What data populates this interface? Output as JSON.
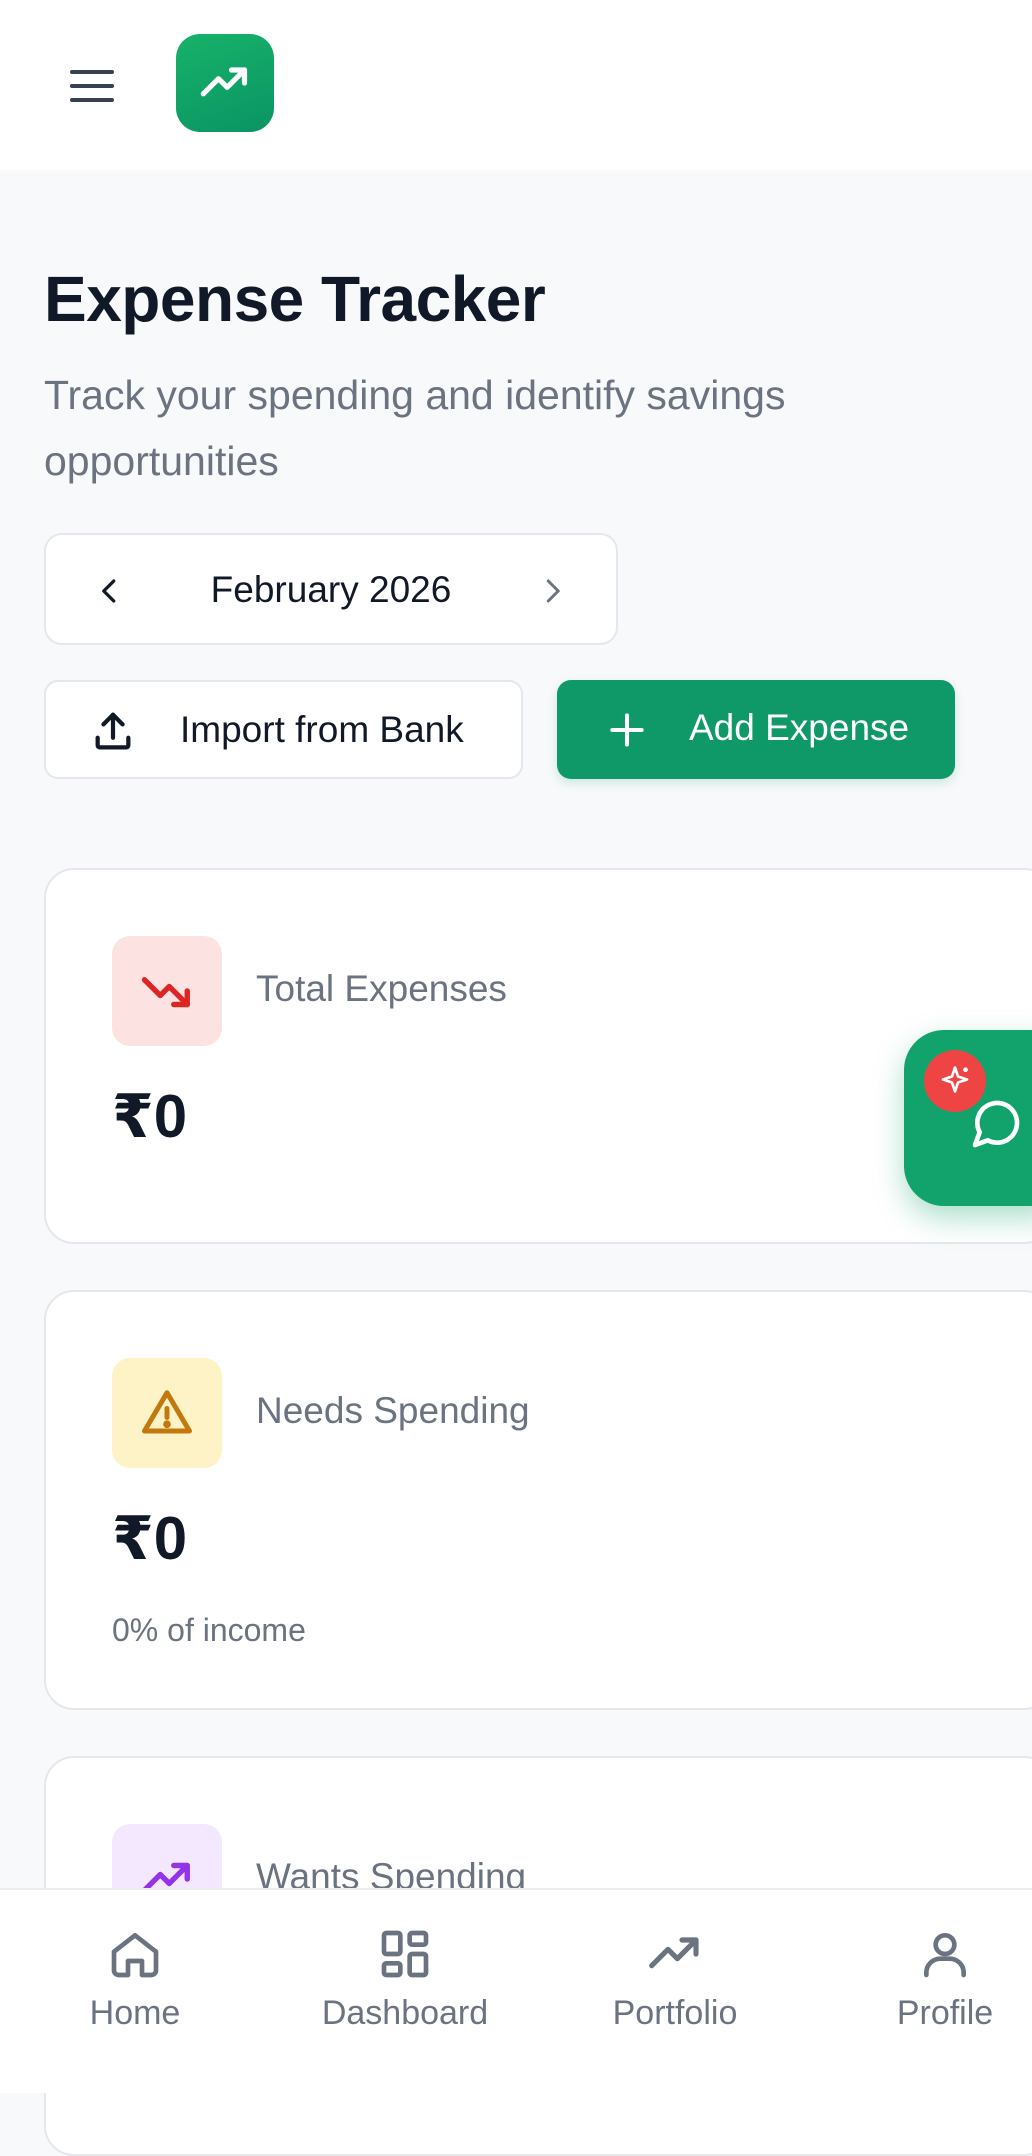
{
  "header": {
    "menu_icon": "hamburger-icon",
    "logo_icon": "trending-up-icon"
  },
  "page": {
    "title": "Expense Tracker",
    "subtitle": "Track your spending and identify savings opportunities"
  },
  "month_picker": {
    "label": "February 2026"
  },
  "actions": {
    "import_label": "Import from Bank",
    "add_label": "Add Expense"
  },
  "cards": [
    {
      "label": "Total Expenses",
      "value": "₹0",
      "icon": "trending-down-icon",
      "badge_color": "#fde2e2",
      "icon_color": "#dc2626"
    },
    {
      "label": "Needs Spending",
      "value": "₹0",
      "note": "0% of income",
      "icon": "warning-icon",
      "badge_color": "#fef3c7",
      "icon_color": "#c2780c"
    },
    {
      "label": "Wants Spending",
      "icon": "trending-up-icon",
      "badge_color": "#f3e8ff",
      "icon_color": "#9333ea"
    }
  ],
  "nav": [
    {
      "label": "Home",
      "icon": "home-icon"
    },
    {
      "label": "Dashboard",
      "icon": "dashboard-icon"
    },
    {
      "label": "Portfolio",
      "icon": "trending-up-icon"
    },
    {
      "label": "Profile",
      "icon": "user-icon"
    }
  ],
  "colors": {
    "brand": "#0f9968",
    "text": "#111827",
    "muted": "#6b7280"
  }
}
